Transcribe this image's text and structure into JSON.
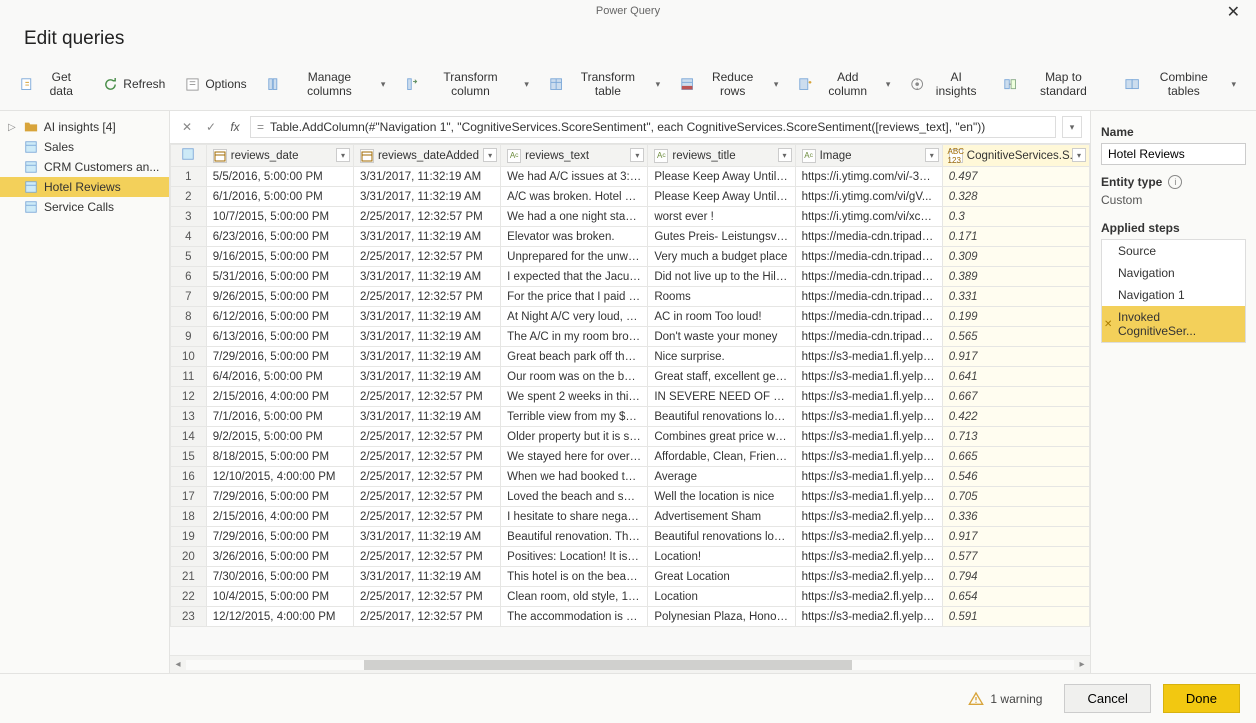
{
  "window": {
    "title": "Power Query",
    "heading": "Edit queries"
  },
  "ribbon": [
    {
      "key": "getdata",
      "label": "Get data",
      "icon": "get-data-icon",
      "drop": false
    },
    {
      "key": "refresh",
      "label": "Refresh",
      "icon": "refresh-icon",
      "drop": false
    },
    {
      "key": "options",
      "label": "Options",
      "icon": "options-icon",
      "drop": false
    },
    {
      "key": "managecols",
      "label": "Manage columns",
      "icon": "manage-columns-icon",
      "drop": true
    },
    {
      "key": "transformcol",
      "label": "Transform column",
      "icon": "transform-column-icon",
      "drop": true
    },
    {
      "key": "transformtbl",
      "label": "Transform table",
      "icon": "transform-table-icon",
      "drop": true
    },
    {
      "key": "reducerows",
      "label": "Reduce rows",
      "icon": "reduce-rows-icon",
      "drop": true
    },
    {
      "key": "addcolumn",
      "label": "Add column",
      "icon": "add-column-icon",
      "drop": true
    },
    {
      "key": "aiinsights",
      "label": "AI insights",
      "icon": "ai-insights-icon",
      "drop": false
    },
    {
      "key": "mapstd",
      "label": "Map to standard",
      "icon": "map-standard-icon",
      "drop": false
    },
    {
      "key": "combine",
      "label": "Combine tables",
      "icon": "combine-tables-icon",
      "drop": true
    }
  ],
  "queries": {
    "header": "AI insights [4]",
    "items": [
      {
        "label": "Sales",
        "selected": false
      },
      {
        "label": "CRM Customers an...",
        "selected": false
      },
      {
        "label": "Hotel Reviews",
        "selected": true
      },
      {
        "label": "Service Calls",
        "selected": false
      }
    ]
  },
  "formula": "Table.AddColumn(#\"Navigation 1\", \"CognitiveServices.ScoreSentiment\", each CognitiveServices.ScoreSentiment([reviews_text], \"en\"))",
  "columns": [
    {
      "name": "reviews_date",
      "type": "cal"
    },
    {
      "name": "reviews_dateAdded",
      "type": "cal"
    },
    {
      "name": "reviews_text",
      "type": "abc"
    },
    {
      "name": "reviews_title",
      "type": "abc"
    },
    {
      "name": "Image",
      "type": "abc"
    },
    {
      "name": "CognitiveServices.S...",
      "type": "abc123",
      "cog": true
    }
  ],
  "rows": [
    {
      "n": 1,
      "c": [
        "5/5/2016, 5:00:00 PM",
        "3/31/2017, 11:32:19 AM",
        "We had A/C issues at 3:30 ...",
        "Please Keep Away Until Co...",
        "https://i.ytimg.com/vi/-3sD...",
        "0.497"
      ]
    },
    {
      "n": 2,
      "c": [
        "6/1/2016, 5:00:00 PM",
        "3/31/2017, 11:32:19 AM",
        "A/C was broken. Hotel was...",
        "Please Keep Away Until Co...",
        "https://i.ytimg.com/vi/gV...",
        "0.328"
      ]
    },
    {
      "n": 3,
      "c": [
        "10/7/2015, 5:00:00 PM",
        "2/25/2017, 12:32:57 PM",
        "We had a one night stay at...",
        "worst ever !",
        "https://i.ytimg.com/vi/xcEB...",
        "0.3"
      ]
    },
    {
      "n": 4,
      "c": [
        "6/23/2016, 5:00:00 PM",
        "3/31/2017, 11:32:19 AM",
        "Elevator was broken.",
        "Gutes Preis- Leistungsverh...",
        "https://media-cdn.tripadvi...",
        "0.171"
      ]
    },
    {
      "n": 5,
      "c": [
        "9/16/2015, 5:00:00 PM",
        "2/25/2017, 12:32:57 PM",
        "Unprepared for the unwelc...",
        "Very much a budget place",
        "https://media-cdn.tripadvi...",
        "0.309"
      ]
    },
    {
      "n": 6,
      "c": [
        "5/31/2016, 5:00:00 PM",
        "3/31/2017, 11:32:19 AM",
        "I expected that the Jacuzzi ...",
        "Did not live up to the Hilto...",
        "https://media-cdn.tripadvi...",
        "0.389"
      ]
    },
    {
      "n": 7,
      "c": [
        "9/26/2015, 5:00:00 PM",
        "2/25/2017, 12:32:57 PM",
        "For the price that I paid for...",
        "Rooms",
        "https://media-cdn.tripadvi...",
        "0.331"
      ]
    },
    {
      "n": 8,
      "c": [
        "6/12/2016, 5:00:00 PM",
        "3/31/2017, 11:32:19 AM",
        "At Night A/C very loud, als...",
        "AC in room Too loud!",
        "https://media-cdn.tripadvi...",
        "0.199"
      ]
    },
    {
      "n": 9,
      "c": [
        "6/13/2016, 5:00:00 PM",
        "3/31/2017, 11:32:19 AM",
        "The A/C in my room broke...",
        "Don't waste your money",
        "https://media-cdn.tripadvi...",
        "0.565"
      ]
    },
    {
      "n": 10,
      "c": [
        "7/29/2016, 5:00:00 PM",
        "3/31/2017, 11:32:19 AM",
        "Great beach park off the la...",
        "Nice surprise.",
        "https://s3-media1.fl.yelpcd...",
        "0.917"
      ]
    },
    {
      "n": 11,
      "c": [
        "6/4/2016, 5:00:00 PM",
        "3/31/2017, 11:32:19 AM",
        "Our room was on the bott...",
        "Great staff, excellent getaw...",
        "https://s3-media1.fl.yelpcd...",
        "0.641"
      ]
    },
    {
      "n": 12,
      "c": [
        "2/15/2016, 4:00:00 PM",
        "2/25/2017, 12:32:57 PM",
        "We spent 2 weeks in this h...",
        "IN SEVERE NEED OF UPDA...",
        "https://s3-media1.fl.yelpcd...",
        "0.667"
      ]
    },
    {
      "n": 13,
      "c": [
        "7/1/2016, 5:00:00 PM",
        "3/31/2017, 11:32:19 AM",
        "Terrible view from my $300...",
        "Beautiful renovations locat...",
        "https://s3-media1.fl.yelpcd...",
        "0.422"
      ]
    },
    {
      "n": 14,
      "c": [
        "9/2/2015, 5:00:00 PM",
        "2/25/2017, 12:32:57 PM",
        "Older property but it is su...",
        "Combines great price with ...",
        "https://s3-media1.fl.yelpcd...",
        "0.713"
      ]
    },
    {
      "n": 15,
      "c": [
        "8/18/2015, 5:00:00 PM",
        "2/25/2017, 12:32:57 PM",
        "We stayed here for over a ...",
        "Affordable, Clean, Friendly ...",
        "https://s3-media1.fl.yelpcd...",
        "0.665"
      ]
    },
    {
      "n": 16,
      "c": [
        "12/10/2015, 4:00:00 PM",
        "2/25/2017, 12:32:57 PM",
        "When we had booked this ...",
        "Average",
        "https://s3-media1.fl.yelpcd...",
        "0.546"
      ]
    },
    {
      "n": 17,
      "c": [
        "7/29/2016, 5:00:00 PM",
        "2/25/2017, 12:32:57 PM",
        "Loved the beach and service",
        "Well the location is nice",
        "https://s3-media1.fl.yelpcd...",
        "0.705"
      ]
    },
    {
      "n": 18,
      "c": [
        "2/15/2016, 4:00:00 PM",
        "2/25/2017, 12:32:57 PM",
        "I hesitate to share negative...",
        "Advertisement Sham",
        "https://s3-media2.fl.yelpcd...",
        "0.336"
      ]
    },
    {
      "n": 19,
      "c": [
        "7/29/2016, 5:00:00 PM",
        "3/31/2017, 11:32:19 AM",
        "Beautiful renovation. The h...",
        "Beautiful renovations locat...",
        "https://s3-media2.fl.yelpcd...",
        "0.917"
      ]
    },
    {
      "n": 20,
      "c": [
        "3/26/2016, 5:00:00 PM",
        "2/25/2017, 12:32:57 PM",
        "Positives: Location! It is on ...",
        "Location!",
        "https://s3-media2.fl.yelpcd...",
        "0.577"
      ]
    },
    {
      "n": 21,
      "c": [
        "7/30/2016, 5:00:00 PM",
        "3/31/2017, 11:32:19 AM",
        "This hotel is on the beach ...",
        "Great Location",
        "https://s3-media2.fl.yelpcd...",
        "0.794"
      ]
    },
    {
      "n": 22,
      "c": [
        "10/4/2015, 5:00:00 PM",
        "2/25/2017, 12:32:57 PM",
        "Clean room, old style, 196...",
        "Location",
        "https://s3-media2.fl.yelpcd...",
        "0.654"
      ]
    },
    {
      "n": 23,
      "c": [
        "12/12/2015, 4:00:00 PM",
        "2/25/2017, 12:32:57 PM",
        "The accommodation is bas...",
        "Polynesian Plaza, Honolulu",
        "https://s3-media2.fl.yelpcd...",
        "0.591"
      ]
    }
  ],
  "properties": {
    "name_label": "Name",
    "name_value": "Hotel Reviews",
    "entity_label": "Entity type",
    "entity_value": "Custom",
    "steps_label": "Applied steps",
    "steps": [
      {
        "label": "Source",
        "selected": false
      },
      {
        "label": "Navigation",
        "selected": false
      },
      {
        "label": "Navigation 1",
        "selected": false
      },
      {
        "label": "Invoked CognitiveSer...",
        "selected": true
      }
    ]
  },
  "footer": {
    "warning": "1 warning",
    "cancel": "Cancel",
    "done": "Done"
  }
}
